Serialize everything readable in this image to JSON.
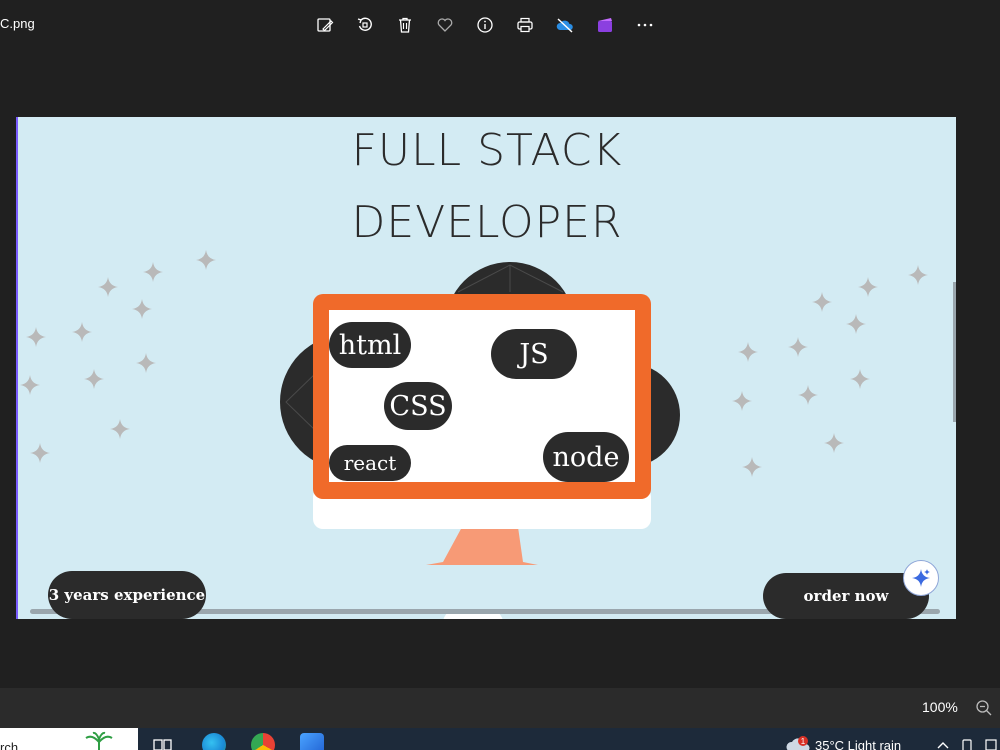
{
  "window": {
    "filename": "C.png"
  },
  "toolbar": {
    "icons": [
      "edit-image-icon",
      "rotate-icon",
      "delete-icon",
      "favorite-icon",
      "info-icon",
      "print-icon",
      "onedrive-icon",
      "clipchamp-icon",
      "more-icon"
    ]
  },
  "image": {
    "title_line1": "FULL STACK",
    "title_line2": "DEVELOPER",
    "chips": {
      "html": "html",
      "js": "JS",
      "css": "CSS",
      "react": "react",
      "node": "node"
    },
    "experience": "3 years experience",
    "order": "order now",
    "colors": {
      "background": "#d3ebf3",
      "monitor_frame": "#f06a2a",
      "stand": "#f79a76",
      "chip": "#2b2b2b"
    }
  },
  "statusbar": {
    "zoom": "100%"
  },
  "taskbar": {
    "search": "rch",
    "weather": "35°C  Light rain",
    "notification_count": "1"
  }
}
